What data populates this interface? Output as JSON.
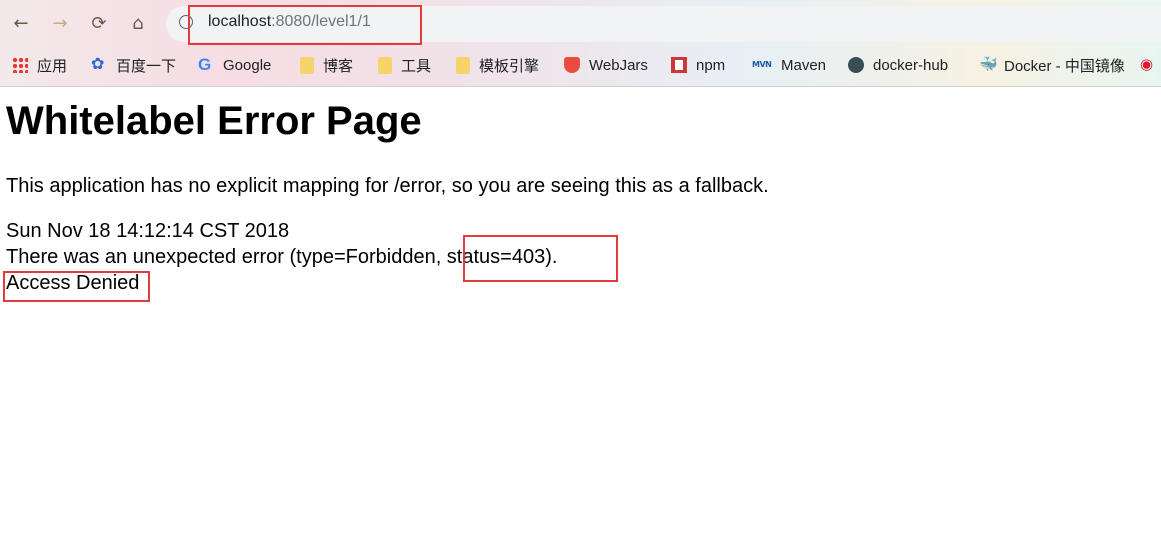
{
  "browser": {
    "url_host": "localhost",
    "url_rest": ":8080/level1/1"
  },
  "bookmarks": [
    {
      "label": "应用",
      "icon": "apps-icon"
    },
    {
      "label": "百度一下",
      "icon": "baidu-icon"
    },
    {
      "label": "Google",
      "icon": "google-icon"
    },
    {
      "label": "博客",
      "icon": "folder-icon"
    },
    {
      "label": "工具",
      "icon": "folder-icon"
    },
    {
      "label": "模板引擎",
      "icon": "folder-icon"
    },
    {
      "label": "WebJars",
      "icon": "webjars-icon"
    },
    {
      "label": "npm",
      "icon": "npm-icon"
    },
    {
      "label": "Maven",
      "icon": "maven-icon"
    },
    {
      "label": "docker-hub",
      "icon": "docker-hub-icon"
    },
    {
      "label": "Docker - 中国镜像",
      "icon": "docker-icon"
    }
  ],
  "page": {
    "title": "Whitelabel Error Page",
    "description": "This application has no explicit mapping for /error, so you are seeing this as a fallback.",
    "timestamp": "Sun Nov 18 14:12:14 CST 2018",
    "error_line": "There was an unexpected error (type=Forbidden, status=403).",
    "message": "Access Denied"
  },
  "colors": {
    "highlight": "#e03c3c"
  }
}
